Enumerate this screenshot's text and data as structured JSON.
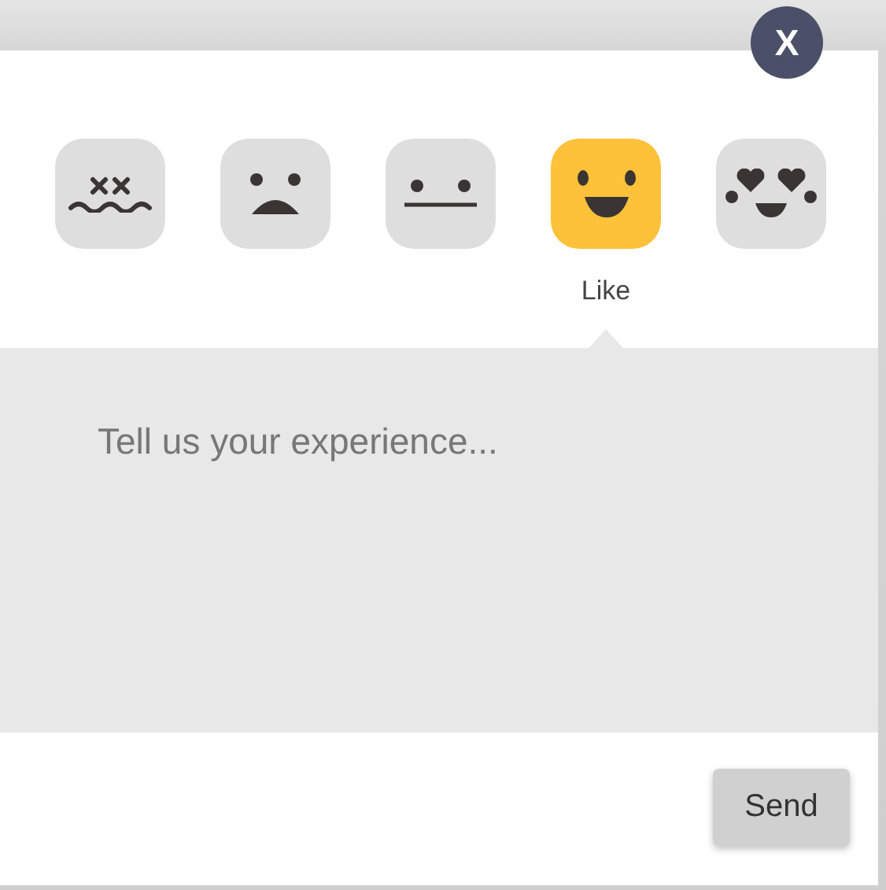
{
  "close_button": {
    "label": "X"
  },
  "faces": [
    {
      "kind": "dizzy",
      "selected": false
    },
    {
      "kind": "sad",
      "selected": false
    },
    {
      "kind": "neutral",
      "selected": false
    },
    {
      "kind": "happy",
      "selected": true,
      "label": "Like"
    },
    {
      "kind": "love",
      "selected": false
    }
  ],
  "comment": {
    "placeholder": "Tell us your experience..."
  },
  "send_button": {
    "label": "Send"
  }
}
